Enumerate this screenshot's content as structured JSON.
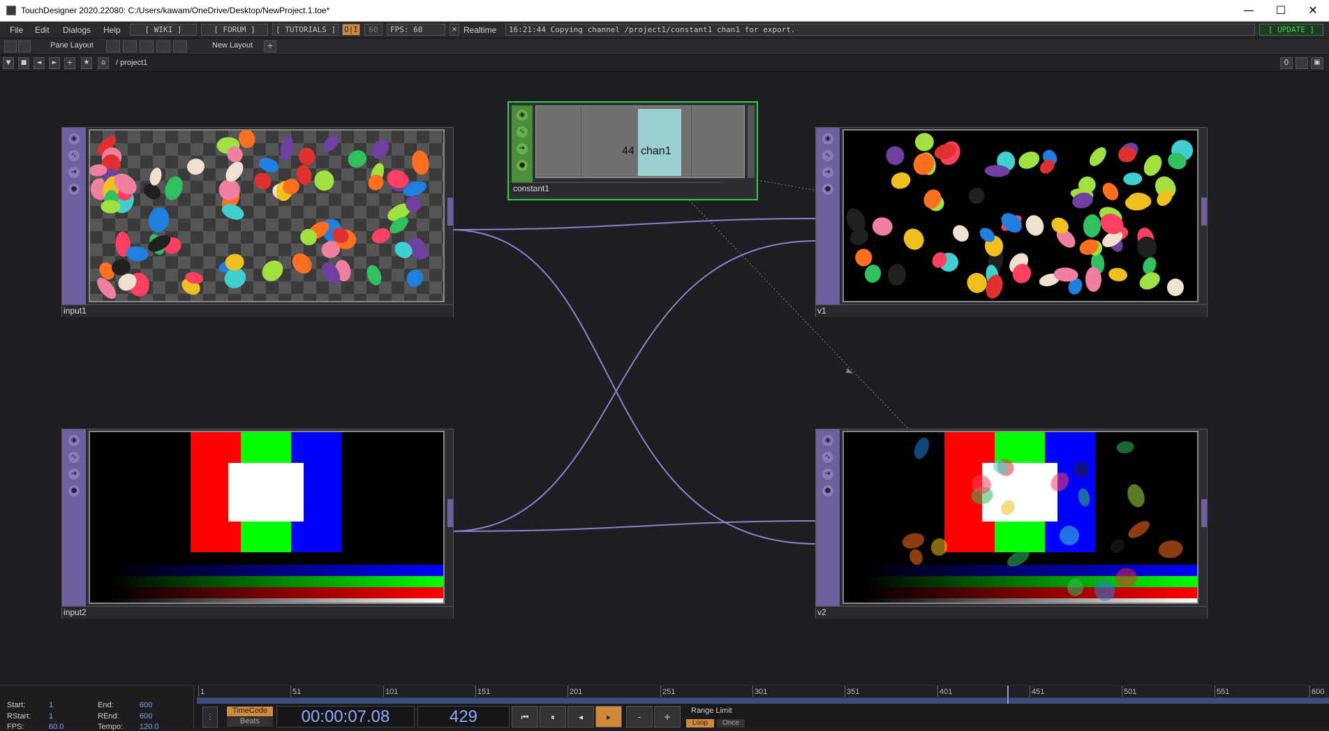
{
  "window": {
    "title": "TouchDesigner 2020.22080: C:/Users/kawam/OneDrive/Desktop/NewProject.1.toe*"
  },
  "menu": {
    "file": "File",
    "edit": "Edit",
    "dialogs": "Dialogs",
    "help": "Help",
    "wiki": "[ WIKI ]",
    "forum": "[ FORUM ]",
    "tutorials": "[ TUTORIALS ]",
    "oi": "O|I",
    "fps_cap": "60",
    "fps": "FPS:  60",
    "realtime": "Realtime",
    "status": "16:21:44 Copying channel /project1/constant1 chan1 for export.",
    "update": "[ UPDATE ]"
  },
  "toolbar": {
    "pane_layout": "Pane Layout",
    "new_layout": "New Layout"
  },
  "pathbar": {
    "path": "/ project1",
    "zero": "0"
  },
  "nodes": {
    "input1": "input1",
    "input2": "input2",
    "v1": "v1",
    "v2": "v2",
    "constant1": "constant1",
    "constant_value": "44",
    "constant_channel": "chan1"
  },
  "timeline": {
    "ticks": [
      "1",
      "51",
      "101",
      "151",
      "201",
      "251",
      "301",
      "351",
      "401",
      "451",
      "501",
      "551",
      "600"
    ],
    "start_label": "Start:",
    "start": "1",
    "end_label": "End:",
    "end": "600",
    "rstart_label": "RStart:",
    "rstart": "1",
    "rend_label": "REnd:",
    "rend": "600",
    "fps_label": "FPS:",
    "fps": "60.0",
    "tempo_label": "Tempo:",
    "tempo": "120.0",
    "timecode_btn": "TimeCode",
    "beats_btn": "Beats",
    "timecode": "00:00:07.08",
    "frame": "429",
    "range_limit": "Range Limit",
    "loop": "Loop",
    "once": "Once",
    "minus": "-",
    "plus": "+"
  },
  "colors": {
    "accent_orange": "#d08a3a",
    "node_purple": "#6f5f9e",
    "wire": "#8f7fd0",
    "constant_green": "#2fd040"
  }
}
